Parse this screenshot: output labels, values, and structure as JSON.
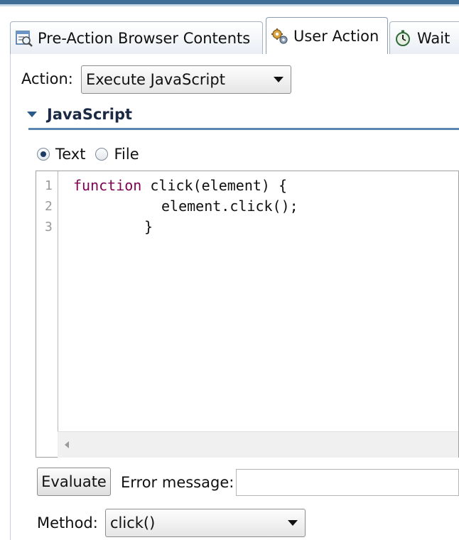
{
  "tabs": [
    {
      "label": "Pre-Action Browser Contents",
      "icon": "browser-contents-icon",
      "active": false
    },
    {
      "label": "User Action",
      "icon": "gears-icon",
      "active": true
    },
    {
      "label": "Wait",
      "icon": "stopwatch-icon",
      "active": false
    }
  ],
  "action": {
    "label": "Action:",
    "value": "Execute JavaScript"
  },
  "section": {
    "title": "JavaScript"
  },
  "source": {
    "options": [
      {
        "label": "Text",
        "selected": true
      },
      {
        "label": "File",
        "selected": false
      }
    ]
  },
  "editor": {
    "lines": [
      {
        "number": "1",
        "keyword": "function",
        "text": " click(element) {"
      },
      {
        "number": "2",
        "keyword": "",
        "text": "element.click();"
      },
      {
        "number": "3",
        "keyword": "",
        "text": "}"
      }
    ]
  },
  "evaluate": {
    "label": "Evaluate"
  },
  "error": {
    "label": "Error message:",
    "value": ""
  },
  "method": {
    "label": "Method:",
    "value": "click()"
  },
  "colors": {
    "accent": "#3e6e96",
    "keyword": "#7f0055",
    "section_line": "#5b86b2"
  }
}
